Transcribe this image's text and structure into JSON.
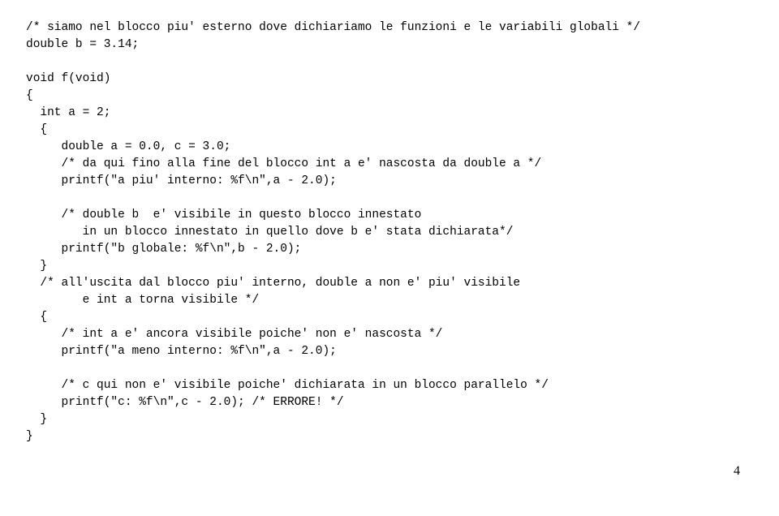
{
  "code": {
    "l01": "/* siamo nel blocco piu' esterno dove dichiariamo le funzioni e le variabili globali */",
    "l02": "double b = 3.14;",
    "l03": "",
    "l04": "void f(void)",
    "l05": "{",
    "l06": "  int a = 2;",
    "l07": "  {",
    "l08": "     double a = 0.0, c = 3.0;",
    "l09": "     /* da qui fino alla fine del blocco int a e' nascosta da double a */",
    "l10": "     printf(\"a piu' interno: %f\\n\",a - 2.0);",
    "l11": "",
    "l12": "     /* double b  e' visibile in questo blocco innestato",
    "l13": "        in un blocco innestato in quello dove b e' stata dichiarata*/",
    "l14": "     printf(\"b globale: %f\\n\",b - 2.0);",
    "l15": "  }",
    "l16": "  /* all'uscita dal blocco piu' interno, double a non e' piu' visibile",
    "l17": "        e int a torna visibile */",
    "l18": "  {",
    "l19": "     /* int a e' ancora visibile poiche' non e' nascosta */",
    "l20": "     printf(\"a meno interno: %f\\n\",a - 2.0);",
    "l21": "",
    "l22": "     /* c qui non e' visibile poiche' dichiarata in un blocco parallelo */",
    "l23": "     printf(\"c: %f\\n\",c - 2.0); /* ERRORE! */",
    "l24": "  }",
    "l25": "}"
  },
  "pageNumber": "4"
}
